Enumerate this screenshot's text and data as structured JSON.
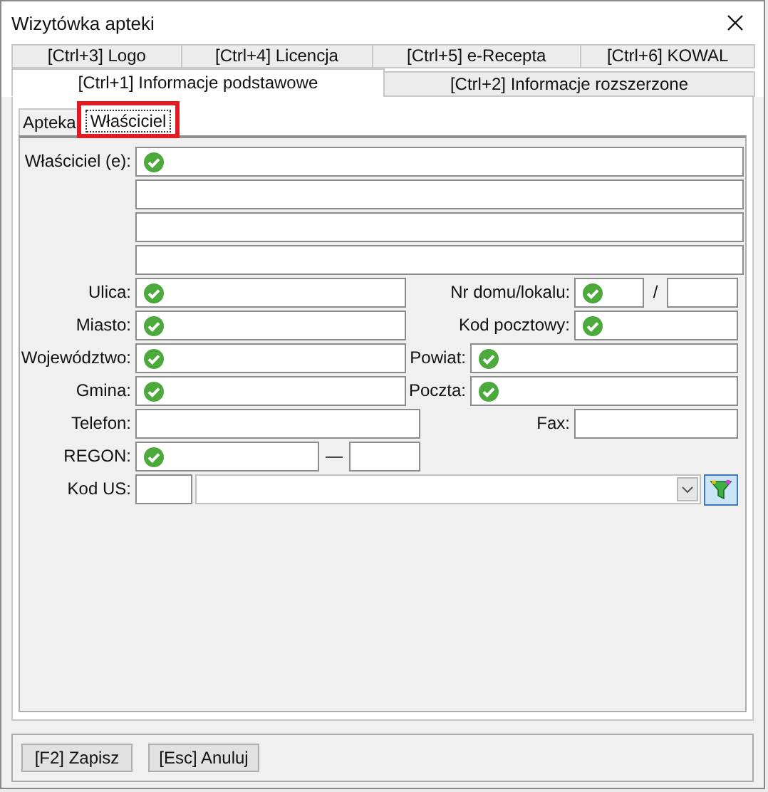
{
  "window": {
    "title": "Wizytówka apteki"
  },
  "tabs_row_1": [
    {
      "label": "[Ctrl+3] Logo",
      "selected": false
    },
    {
      "label": "[Ctrl+4] Licencja",
      "selected": false
    },
    {
      "label": "[Ctrl+5] e-Recepta",
      "selected": false
    },
    {
      "label": "[Ctrl+6] KOWAL",
      "selected": false
    }
  ],
  "tabs_row_2": [
    {
      "label": "[Ctrl+1] Informacje podstawowe",
      "selected": true
    },
    {
      "label": "[Ctrl+2] Informacje rozszerzone",
      "selected": false
    }
  ],
  "subtabs": [
    {
      "label": "Apteka",
      "selected": false,
      "highlighted": false
    },
    {
      "label": "Właściciel",
      "selected": true,
      "highlighted": true
    }
  ],
  "owner": {
    "label": "Właściciel (e):",
    "lines": [
      {
        "validated": true
      },
      {
        "validated": false
      },
      {
        "validated": false
      },
      {
        "validated": false
      }
    ]
  },
  "rows": [
    {
      "kind": "house",
      "left": {
        "label": "Ulica:",
        "validated": true
      },
      "right": {
        "label": "Nr domu/lokalu:",
        "validated": true
      },
      "separator": "/",
      "extra": {
        "validated": false
      }
    },
    {
      "kind": "pair",
      "left": {
        "label": "Miasto:",
        "validated": true
      },
      "right": {
        "label": "Kod pocztowy:",
        "validated": true
      }
    },
    {
      "kind": "pair-wide",
      "left": {
        "label": "Województwo:",
        "validated": true
      },
      "right": {
        "label": "Powiat:",
        "validated": true
      }
    },
    {
      "kind": "pair-wide",
      "left": {
        "label": "Gmina:",
        "validated": true
      },
      "right": {
        "label": "Poczta:",
        "validated": true
      }
    },
    {
      "kind": "phone",
      "left": {
        "label": "Telefon:",
        "validated": false
      },
      "right": {
        "label": "Fax:",
        "validated": false
      }
    },
    {
      "kind": "regon",
      "left": {
        "label": "REGON:",
        "validated": true
      },
      "separator": "—",
      "extra": {
        "validated": false
      }
    },
    {
      "kind": "office",
      "left": {
        "label": "Kod US:",
        "validated": false
      }
    }
  ],
  "buttons": [
    {
      "label": "[F2] Zapisz"
    },
    {
      "label": "[Esc] Anuluj"
    }
  ]
}
